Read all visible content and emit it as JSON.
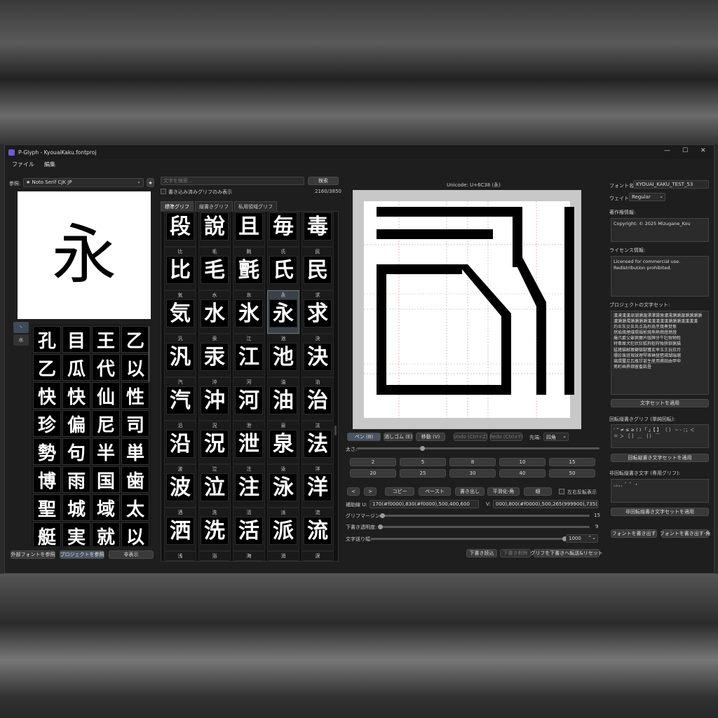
{
  "window": {
    "title": "P-Glyph - KyouaiKaku.fontproj"
  },
  "menu": {
    "file": "ファイル",
    "edit": "編集"
  },
  "reference": {
    "label": "参照:",
    "font": "★ Noto Serif CJK JP",
    "char": "永",
    "strip": [
      "丶",
      "水"
    ],
    "glyphs": [
      "孔",
      "目",
      "王",
      "乙",
      "乙",
      "瓜",
      "代",
      "以",
      "快",
      "快",
      "仙",
      "性",
      "珍",
      "偏",
      "尼",
      "司",
      "勢",
      "句",
      "半",
      "単",
      "博",
      "雨",
      "国",
      "歯",
      "聖",
      "城",
      "域",
      "太",
      "艇",
      "実",
      "就",
      "以"
    ],
    "buttons": {
      "external": "外部フォントを参照",
      "project": "プロジェクトを参照",
      "hide": "非表示"
    }
  },
  "search": {
    "placeholder": "文字を検索...",
    "button": "検索",
    "filter_label": "書き込み済みグリフのみ表示",
    "count": "2160/3850"
  },
  "tabs": [
    "標準グリフ",
    "縦書きグリフ",
    "私用領域グリフ"
  ],
  "charlist": {
    "rows": [
      [
        "",
        "",
        "",
        "",
        ""
      ],
      [
        "比",
        "毛",
        "氈",
        "氏",
        "民"
      ],
      [
        "気",
        "水",
        "氷",
        "永",
        "求"
      ],
      [
        "汎",
        "汞",
        "江",
        "池",
        "決"
      ],
      [
        "汽",
        "沖",
        "河",
        "油",
        "治"
      ],
      [
        "沿",
        "況",
        "泄",
        "泉",
        "法"
      ],
      [
        "波",
        "泣",
        "注",
        "泳",
        "洋"
      ],
      [
        "洒",
        "洗",
        "活",
        "派",
        "流"
      ],
      [
        "浅",
        "浴",
        "海",
        "消",
        "涙"
      ]
    ],
    "top_glyphs": [
      "段",
      "說",
      "且",
      "毎",
      "毒"
    ],
    "glyphs": [
      [
        "比",
        "毛",
        "氈",
        "氏",
        "民"
      ],
      [
        "気",
        "水",
        "氷",
        "永",
        "求"
      ],
      [
        "汎",
        "汞",
        "江",
        "池",
        "決"
      ],
      [
        "汽",
        "沖",
        "河",
        "油",
        "治"
      ],
      [
        "沿",
        "況",
        "泄",
        "泉",
        "法"
      ],
      [
        "波",
        "泣",
        "注",
        "泳",
        "洋"
      ],
      [
        "洒",
        "洗",
        "活",
        "派",
        "流"
      ],
      [
        "浅",
        "浴",
        "海",
        "消",
        "涙"
      ]
    ]
  },
  "editor": {
    "unicode": "Unicode: U+6C38 (永)",
    "tools": {
      "pen": "ペン (B)",
      "eraser": "消しゴム (E)",
      "move": "移動 (V)",
      "undo": "Undo (Ctrl+Z)",
      "redo": "Redo (Ctrl+Y)",
      "tip_label": "先端:",
      "tip_value": "四角"
    },
    "thickness_label": "太さ:",
    "thickness_fraction": 0.27,
    "presets": [
      "2",
      "5",
      "8",
      "10",
      "15",
      "20",
      "25",
      "30",
      "40",
      "50"
    ],
    "actions": {
      "prev": "<",
      "next": ">",
      "copy": "コピー",
      "paste": "ペースト",
      "write": "書き出し",
      "smooth": "平滑化-角",
      "thin": "細",
      "mirror": "左右反転表示"
    },
    "guides": {
      "u_label": "補助線 U:",
      "u_value": "170(#f0000),830(#f0000),500,400,600",
      "v_label": "V:",
      "v_value": "000),800(#f0000),500,265(999900),735(999900)"
    },
    "margin": {
      "label": "グリフマージン:",
      "value": "15",
      "fraction": 0.02
    },
    "draft_alpha": {
      "label": "下書き透明度:",
      "value": "9",
      "fraction": 0.01
    },
    "advance": {
      "label": "文字送り幅:",
      "value": "1000",
      "fraction": 1.0
    },
    "draft_buttons": {
      "load": "下書き読込",
      "delete": "下書き削除",
      "transfer": "グリフを下書きへ転送&リセット"
    }
  },
  "props": {
    "font_name_label": "フォント名:",
    "font_name": "KYOUAI_KAKU_TEST_53",
    "weight_label": "ウェイト:",
    "weight": "Regular",
    "copyright_label": "著作権情報:",
    "copyright": "Copyright: © 2025 Mizugane_Kou",
    "license_label": "ライセンス情報:",
    "license": "Licensed for commercial use.\nRedistribution prohibited.",
    "charset_label": "プロジェクトの文字セット:",
    "charset": "漢漠漢漢漸潮瀬瀧漂澤澱激濃濡瀬瀬瀧瀬瀬瀬瀬\n濃瀬瀬濁瀬瀬瀬瀬漢漢漢漢漢瀬瀬瀬漢漢漢漢\n灼炎灰災炎炎点為烈烏烹焼煮焚焦\n然焔焼煙煤照煩煎焼熊熱燃燈燃燈\n爆爪爵父爺爽爾片版牌牙牛牡牧物牲\n特牽犀犬犯状狂狐狗狙狩独狭狼猟猫\n猛猪猫献猿獅獄獣獲玄率玉王玩玖玲\n珊珍珠班現球理琴琢琳琵琶瑛瑚瑞瑠\n璃環璽瓜瓦瓶甘甚生産用甫田由甲申\n男町画界畑留畜畝畳",
    "charset_button": "文字セットを適用",
    "rot_label": "回転縦書きグリフ (単純回転):",
    "rot_value": "‘ “ ≠ ≤ ≥ ( ) 「 」【 】 〔 〕 ~ - ：；＜\n＝ ＞ ［ ］ ＿ ｛ ｝ ￣",
    "rot_button": "回転縦書き文字セットを適用",
    "nonrot_label": "非回転縦書き文字 (専用グリフ):",
    "nonrot_value": "、。，．゛゜・",
    "nonrot_button": "非回転縦書き文字セットを適用",
    "export": "フォントを書き出す",
    "export_vert": "フォントを書き出す-角"
  }
}
